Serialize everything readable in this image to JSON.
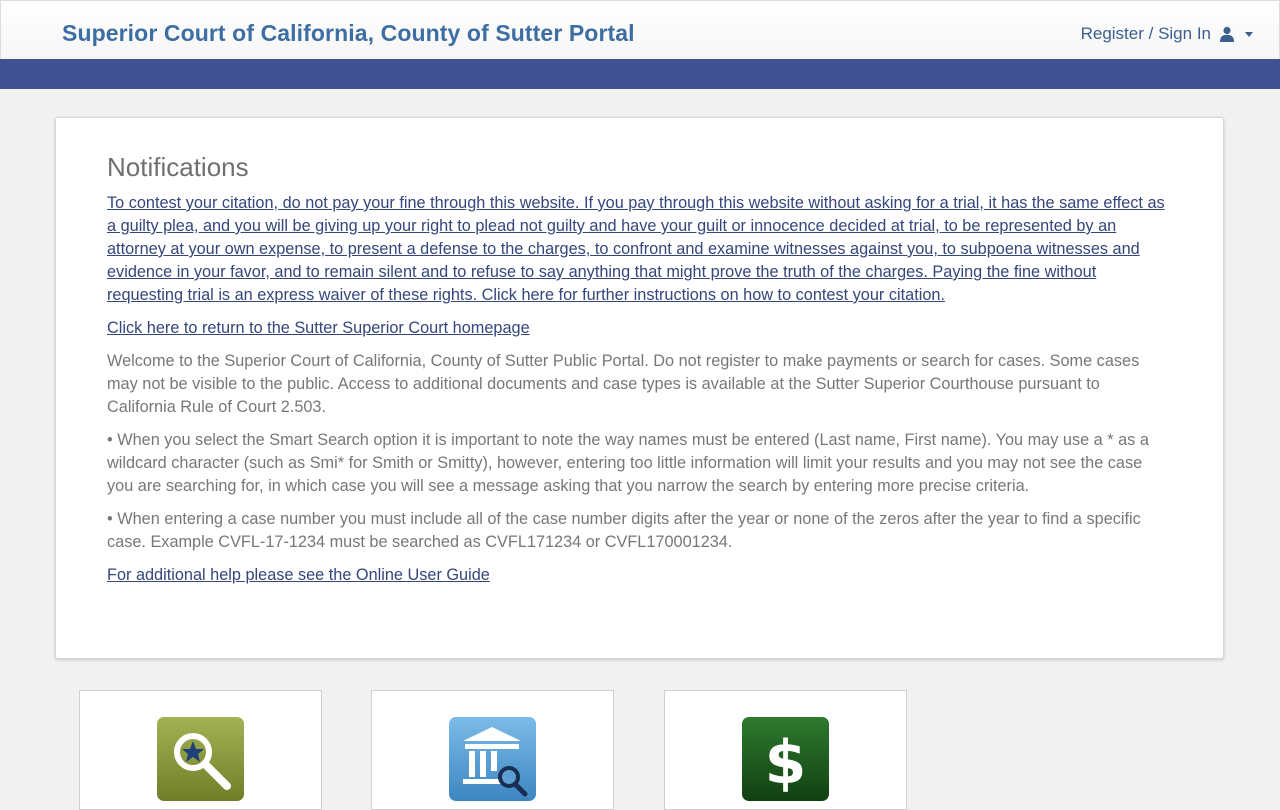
{
  "header": {
    "title": "Superior Court of California, County of Sutter Portal",
    "signin_label": "Register / Sign In",
    "icons": [
      "user-icon",
      "caret-down-icon"
    ]
  },
  "notifications": {
    "heading": "Notifications",
    "contest_link": "To contest your citation, do not pay your fine through this website. If you pay through this website without asking for a trial, it has the same effect as a guilty plea, and you will be giving up your right to plead not guilty and have your guilt or innocence decided at trial, to be represented by an attorney at your own expense, to present a defense to the charges, to confront and examine witnesses against you, to subpoena witnesses and evidence in your favor, and to remain silent and to refuse to say anything that might prove the truth of the charges. Paying the fine without requesting trial is an express waiver of these rights. Click here for further instructions on how to contest your citation.",
    "homepage_link": "Click here to return to the Sutter Superior Court homepage",
    "welcome_text": "Welcome to the Superior Court of California, County of Sutter Public Portal. Do not register to make payments or search for cases. Some cases may not be visible to the public. Access to additional documents and case types is available at the Sutter Superior Courthouse pursuant to California Rule of Court 2.503.",
    "smart_search_text": "• When you select the Smart Search option it is important to note the way names must be entered (Last name, First name). You may use a * as a wildcard character (such as Smi* for Smith or Smitty), however, entering too little information will limit your results and you may not see the case you are searching for, in which case you will see a message asking that you narrow the search by entering more precise criteria.",
    "case_number_text": "• When entering a case number you must include all of the case number digits after the year or none of the zeros after the year to find a specific case. Example CVFL-17-1234 must be searched as CVFL171234 or CVFL170001234.",
    "guide_link": "For additional help please see the Online User Guide"
  },
  "tiles": [
    {
      "icon": "smart-search-icon"
    },
    {
      "icon": "court-search-icon"
    },
    {
      "icon": "payment-dollar-icon"
    }
  ],
  "colors": {
    "brand": "#3d6ea3",
    "navbar": "#3f5190",
    "link": "#34467c",
    "smart_search_tile": "#8a9a3c",
    "court_search_tile": "#5b9fd3",
    "payment_tile": "#1f5a1f"
  }
}
